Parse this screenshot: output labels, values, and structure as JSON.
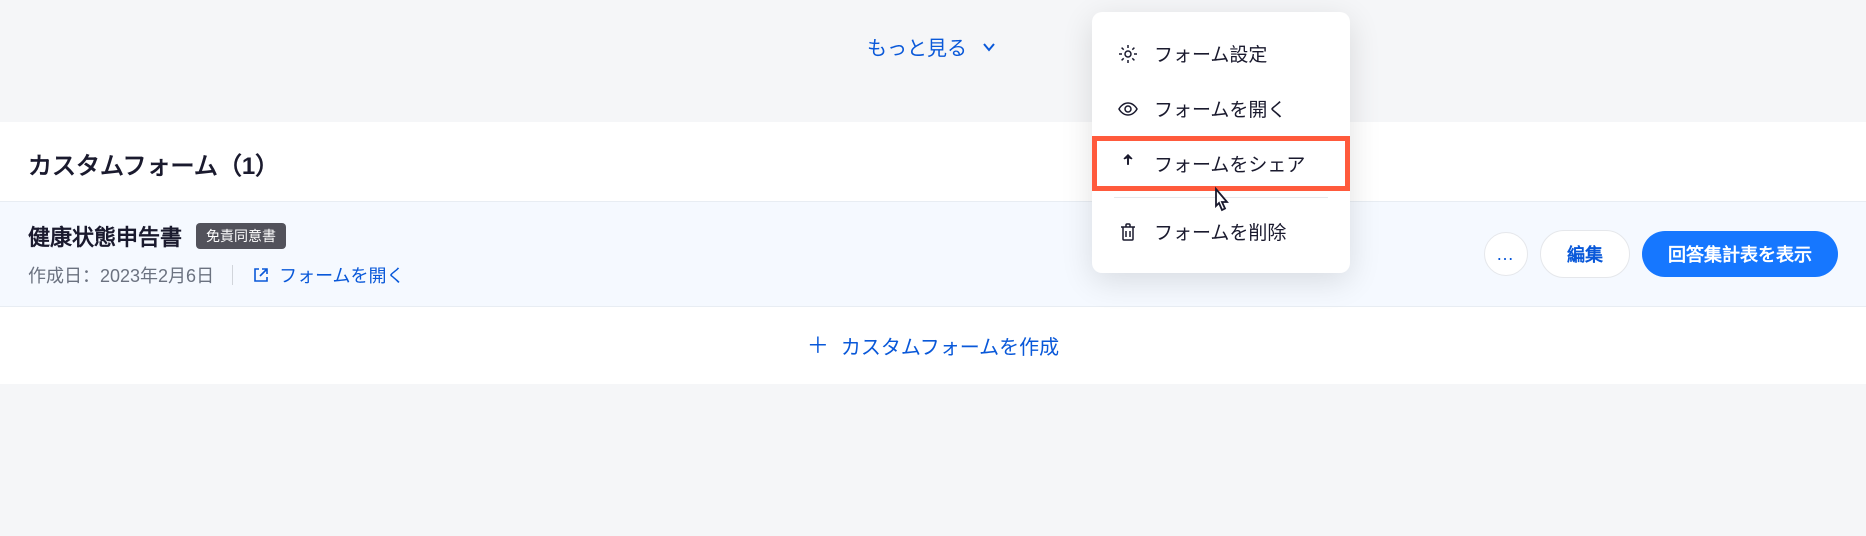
{
  "topBar": {
    "showMoreLabel": "もっと見る"
  },
  "section": {
    "title": "カスタムフォーム（1）"
  },
  "formItem": {
    "title": "健康状態申告書",
    "badge": "免責同意書",
    "createdLabel": "作成日：2023年2月6日",
    "openFormLabel": "フォームを開く",
    "moreLabel": "…",
    "editLabel": "編集",
    "showSummaryLabel": "回答集計表を表示"
  },
  "createForm": {
    "label": "カスタムフォームを作成"
  },
  "dropdown": {
    "settings": "フォーム設定",
    "open": "フォームを開く",
    "share": "フォームをシェア",
    "delete": "フォームを削除"
  }
}
